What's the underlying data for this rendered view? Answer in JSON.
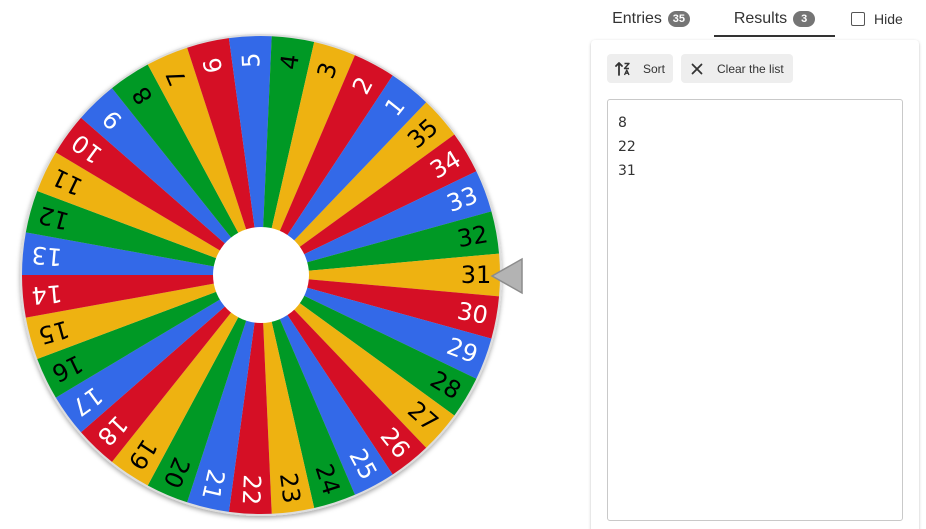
{
  "wheel": {
    "segments": [
      "35",
      "34",
      "33",
      "32",
      "31",
      "30",
      "29",
      "28",
      "27",
      "26",
      "25",
      "24",
      "23",
      "22",
      "21",
      "20",
      "19",
      "18",
      "17",
      "16",
      "15",
      "14",
      "13",
      "12",
      "11",
      "10",
      "9",
      "8",
      "7",
      "6",
      "5",
      "4",
      "3",
      "2",
      "1"
    ],
    "segment_colors": [
      "#eeb211",
      "#d50f25",
      "#3369e8",
      "#009925",
      "#eeb211",
      "#d50f25",
      "#3369e8",
      "#009925",
      "#eeb211",
      "#d50f25",
      "#3369e8",
      "#009925",
      "#eeb211",
      "#d50f25",
      "#3369e8",
      "#009925",
      "#eeb211",
      "#d50f25",
      "#3369e8",
      "#009925",
      "#eeb211",
      "#d50f25",
      "#3369e8",
      "#009925",
      "#eeb211",
      "#d50f25",
      "#3369e8",
      "#009925",
      "#eeb211",
      "#d50f25",
      "#3369e8",
      "#009925",
      "#eeb211",
      "#d50f25",
      "#3369e8"
    ],
    "label_colors": [
      "#000000",
      "#ffffff",
      "#ffffff",
      "#000000",
      "#000000",
      "#ffffff",
      "#ffffff",
      "#000000",
      "#000000",
      "#ffffff",
      "#ffffff",
      "#000000",
      "#000000",
      "#ffffff",
      "#ffffff",
      "#000000",
      "#000000",
      "#ffffff",
      "#ffffff",
      "#000000",
      "#000000",
      "#ffffff",
      "#ffffff",
      "#000000",
      "#000000",
      "#ffffff",
      "#ffffff",
      "#000000",
      "#000000",
      "#ffffff",
      "#ffffff",
      "#000000",
      "#000000",
      "#ffffff",
      "#ffffff"
    ],
    "selected": "31"
  },
  "tabs": {
    "entries_label": "Entries",
    "entries_count": "35",
    "results_label": "Results",
    "results_count": "3",
    "hide_label": "Hide"
  },
  "results": {
    "sort_label": "Sort",
    "sort_icon": "sort-icon",
    "clear_label": "Clear the list",
    "clear_icon": "close-icon",
    "lines": [
      "8",
      "22",
      "31"
    ]
  }
}
